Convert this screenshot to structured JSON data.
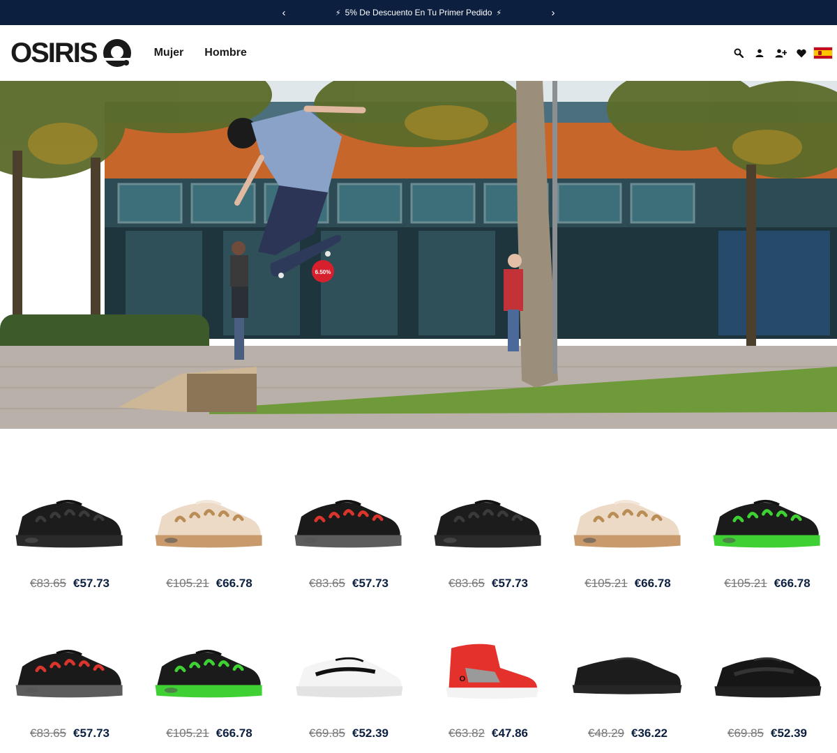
{
  "announcement": {
    "text": "5% De Descuento En Tu Primer Pedido",
    "prev_icon": "chevron-left-icon",
    "next_icon": "chevron-right-icon",
    "decor_icon": "lightning-bolt-icon"
  },
  "header": {
    "logo_text": "OSIRIS",
    "nav": [
      "Mujer",
      "Hombre"
    ],
    "icons": [
      "search-icon",
      "user-icon",
      "add-user-icon",
      "heart-icon",
      "spain-flag-icon"
    ]
  },
  "hero": {
    "sticker_text": "6.50%"
  },
  "colors": {
    "brand_navy": "#0c1f3f",
    "accent_green": "#3fd133",
    "accent_red": "#e5312b"
  },
  "products": [
    {
      "style": "d3-black",
      "old_price": "€83.65",
      "new_price": "€57.73"
    },
    {
      "style": "d3-cream",
      "old_price": "€105.21",
      "new_price": "€66.78"
    },
    {
      "style": "d3-black-red",
      "old_price": "€83.65",
      "new_price": "€57.73"
    },
    {
      "style": "d3-black",
      "old_price": "€83.65",
      "new_price": "€57.73"
    },
    {
      "style": "d3-cream",
      "old_price": "€105.21",
      "new_price": "€66.78"
    },
    {
      "style": "d3-black-green",
      "old_price": "€105.21",
      "new_price": "€66.78"
    },
    {
      "style": "d3-black-red",
      "old_price": "€83.65",
      "new_price": "€57.73"
    },
    {
      "style": "d3-black-green",
      "old_price": "€105.21",
      "new_price": "€66.78"
    },
    {
      "style": "runner-white",
      "old_price": "€69.85",
      "new_price": "€52.39"
    },
    {
      "style": "hightop-red",
      "old_price": "€63.82",
      "new_price": "€47.86"
    },
    {
      "style": "lowtop-black",
      "old_price": "€48.29",
      "new_price": "€36.22"
    },
    {
      "style": "runner-black",
      "old_price": "€69.85",
      "new_price": "€52.39"
    }
  ]
}
